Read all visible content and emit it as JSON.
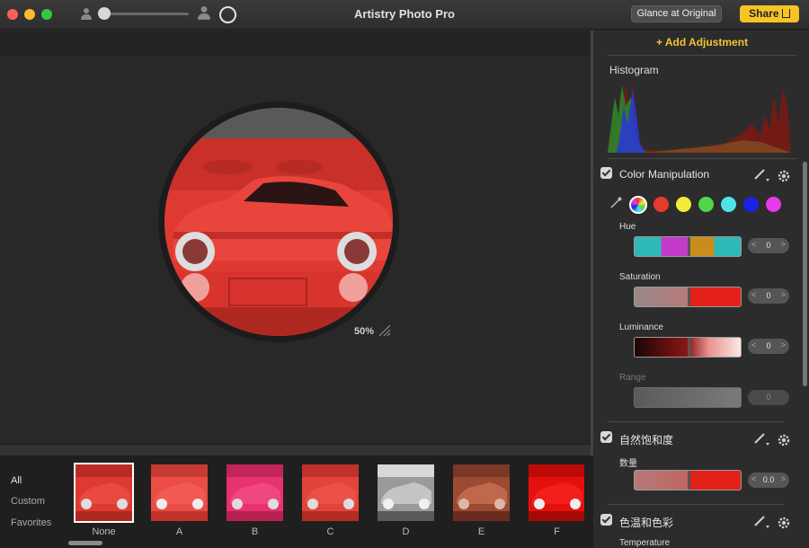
{
  "window": {
    "title": "Artistry Photo Pro"
  },
  "toolbar": {
    "glance_label": "Glance at Original",
    "share_label": "Share"
  },
  "canvas": {
    "zoom": "50%"
  },
  "filmstrip": {
    "categories": [
      "All",
      "Custom",
      "Favorites"
    ],
    "presets": [
      {
        "label": "None",
        "selected": true
      },
      {
        "label": "A"
      },
      {
        "label": "B"
      },
      {
        "label": "C"
      },
      {
        "label": "D"
      },
      {
        "label": "E"
      },
      {
        "label": "F"
      }
    ]
  },
  "panel": {
    "add_adjustment": "Add Adjustment",
    "histogram_title": "Histogram",
    "color_manipulation": {
      "title": "Color Manipulation",
      "swatch_colors": [
        "#e8392f",
        "#f1ec3a",
        "#4fd64a",
        "#4fe3e8",
        "#1a22e6",
        "#e53be8"
      ],
      "hue_label": "Hue",
      "hue_value": "0",
      "saturation_label": "Saturation",
      "saturation_value": "0",
      "luminance_label": "Luminance",
      "luminance_value": "0",
      "range_label": "Range",
      "range_value": "0"
    },
    "vibrance": {
      "title": "自然饱和度",
      "amount_label": "数量",
      "amount_value": "0.0"
    },
    "temp_tint": {
      "title": "色温和色彩",
      "temperature_label": "Temperature"
    }
  },
  "colors": {
    "accent": "#f6c525",
    "photo_red": "#e23a33"
  }
}
